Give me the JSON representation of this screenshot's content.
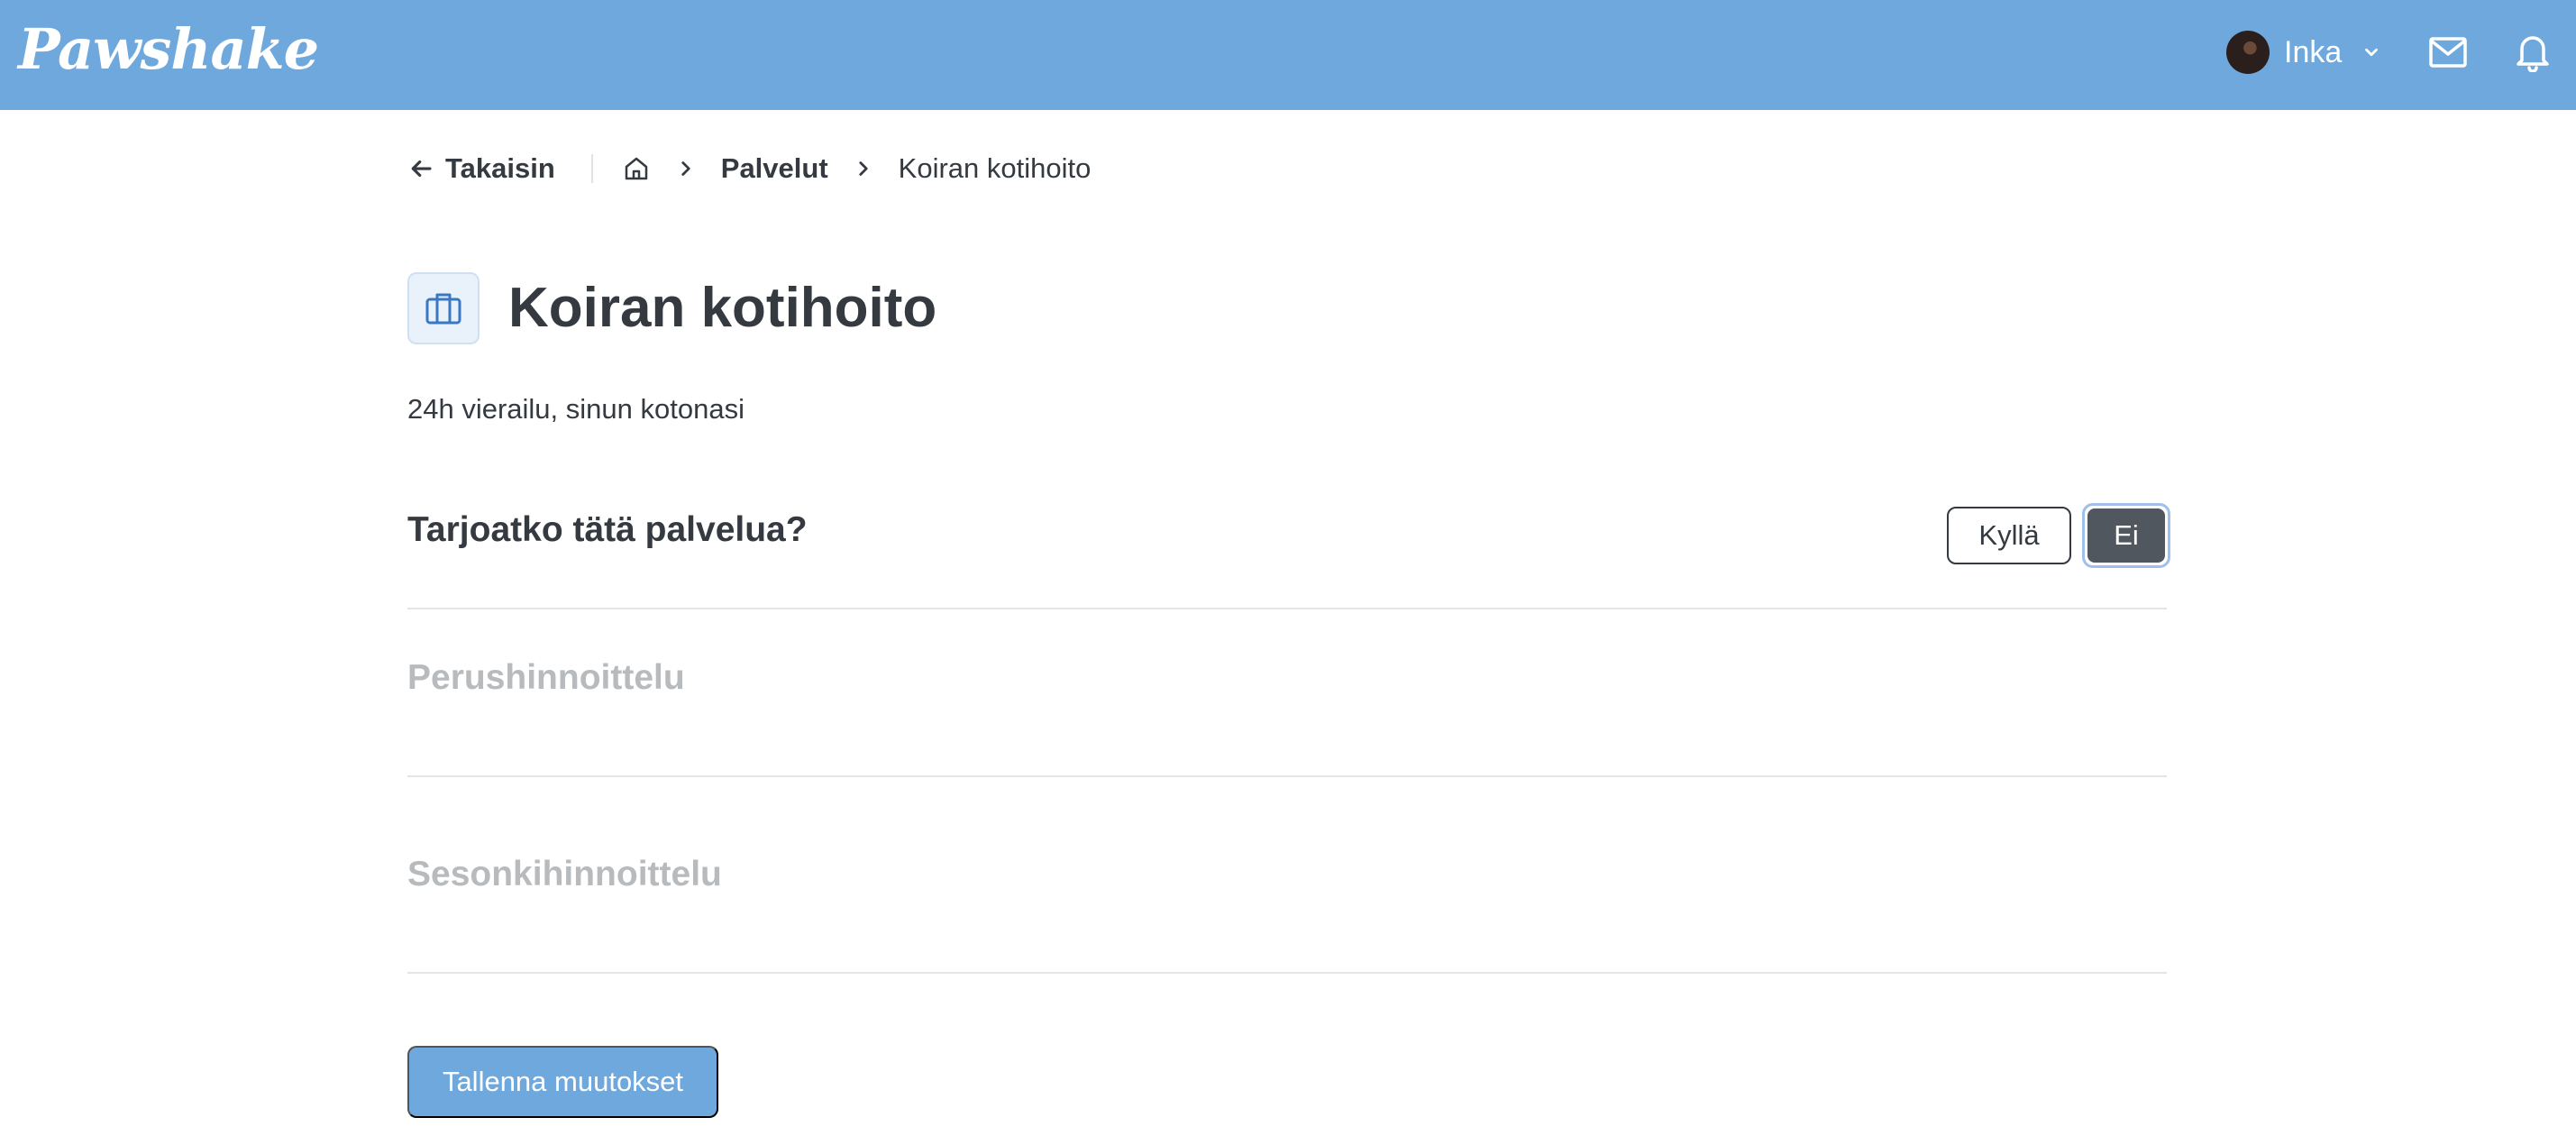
{
  "header": {
    "logo": "Pawshake",
    "user_name": "Inka",
    "icons": [
      "avatar",
      "chevron-down-icon",
      "mail-icon",
      "bell-icon"
    ],
    "color": "#6fa8dc"
  },
  "breadcrumb": {
    "back_label": "Takaisin",
    "items": [
      "Palvelut",
      "Koiran kotihoito"
    ]
  },
  "page": {
    "title": "Koiran kotihoito",
    "subtitle": "24h vierailu, sinun kotonasi",
    "icon": "briefcase-icon"
  },
  "offer": {
    "question": "Tarjoatko tätä palvelua?",
    "yes_label": "Kyllä",
    "no_label": "Ei",
    "selected": "Ei"
  },
  "sections": {
    "base_pricing": "Perushinnoittelu",
    "seasonal_pricing": "Sesonkihinnoittelu"
  },
  "actions": {
    "save_label": "Tallenna muutokset"
  }
}
